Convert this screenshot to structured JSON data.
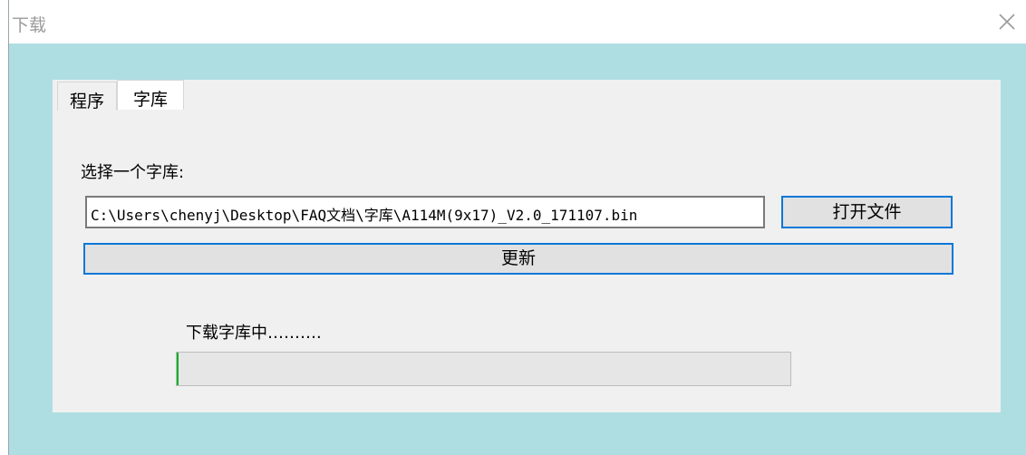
{
  "window": {
    "title": "下载"
  },
  "tabs": [
    {
      "label": "程序",
      "active": false
    },
    {
      "label": "字库",
      "active": true
    }
  ],
  "form": {
    "select_label": "选择一个字库:",
    "path_value": "C:\\Users\\chenyj\\Desktop\\FAQ文档\\字库\\A114M(9x17)_V2.0_171107.bin",
    "open_button": "打开文件",
    "update_button": "更新"
  },
  "status": {
    "text": "下载字库中……….",
    "progress_fraction": 0.003
  },
  "colors": {
    "window_bg": "#aedee2",
    "panel_bg": "#f0f0f0",
    "button_border": "#0a78d7",
    "progress_fill": "#06b025"
  }
}
